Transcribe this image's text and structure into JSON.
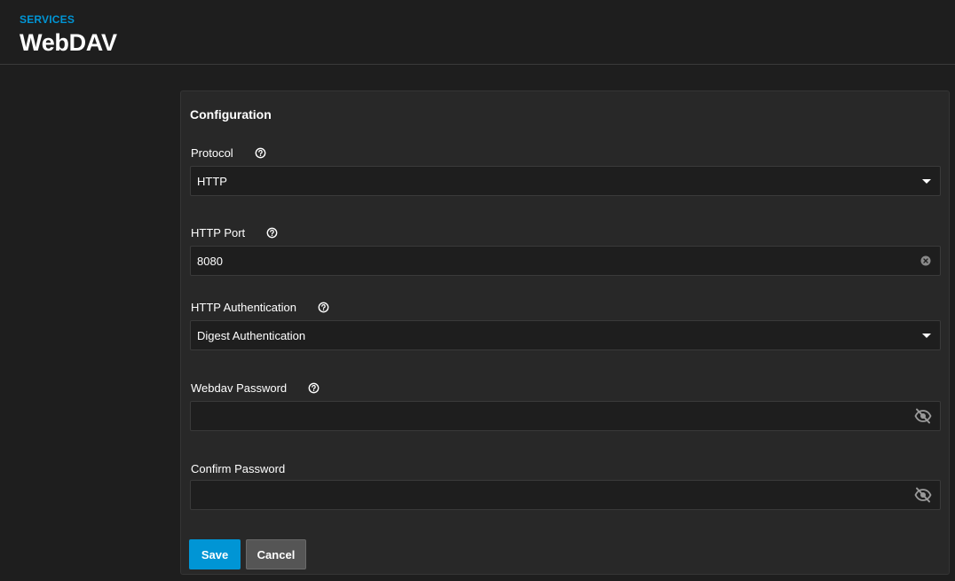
{
  "header": {
    "breadcrumb": "SERVICES",
    "title": "WebDAV"
  },
  "card": {
    "title": "Configuration",
    "fields": {
      "protocol": {
        "label": "Protocol",
        "value": "HTTP"
      },
      "http_port": {
        "label": "HTTP Port",
        "value": "8080"
      },
      "http_auth": {
        "label": "HTTP Authentication",
        "value": "Digest Authentication"
      },
      "webdav_password": {
        "label": "Webdav Password",
        "value": ""
      },
      "confirm_password": {
        "label": "Confirm Password",
        "value": ""
      }
    },
    "buttons": {
      "save": "Save",
      "cancel": "Cancel"
    }
  },
  "colors": {
    "accent": "#0095d5",
    "background": "#1e1e1e",
    "card": "#282828"
  },
  "icons": {
    "help": "help-circle-icon",
    "dropdown": "caret-down-icon",
    "clear": "clear-circle-icon",
    "visibility": "eye-off-icon"
  }
}
